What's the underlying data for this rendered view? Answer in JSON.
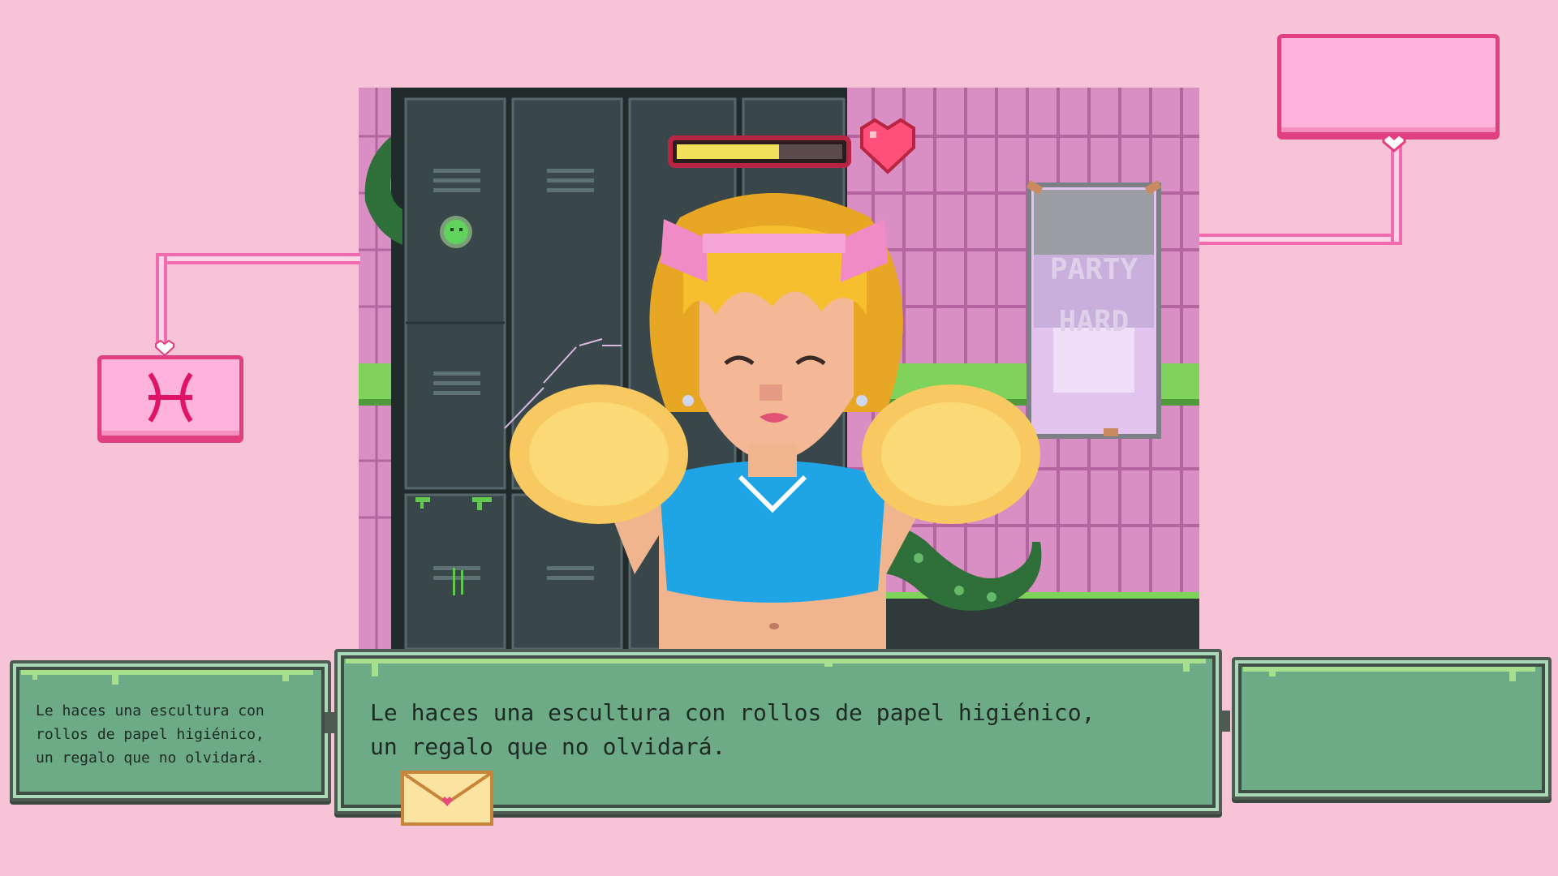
{
  "dialogue": {
    "main_text": "Le haces una escultura con rollos de papel higiénico,\nun regalo que no olvidará.",
    "history_text": "Le haces una escultura con\nrollos de papel higiénico,\nun regalo que no olvidará.",
    "right_text": ""
  },
  "name_box": {
    "label": ""
  },
  "zodiac": {
    "symbol": "♓",
    "icon": "pisces-icon"
  },
  "affection_meter": {
    "level": 0.62
  },
  "poster": {
    "text_line1": "PARTY",
    "text_line2": "HARD"
  },
  "colors": {
    "background": "#f7c3d7",
    "pink_accent": "#e0407f",
    "panel_green": "#6cab86",
    "meter_fill": "#f0e05a",
    "heart": "#ff4f7a"
  }
}
